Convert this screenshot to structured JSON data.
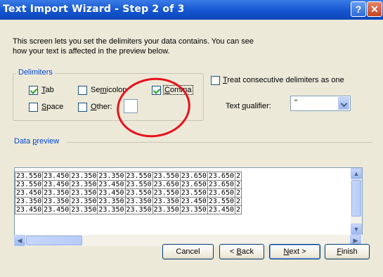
{
  "window": {
    "title": "Text Import Wizard - Step 2 of 3",
    "help_glyph": "?",
    "close_glyph": "✕"
  },
  "intro": {
    "line1": "This screen lets you set the delimiters your data contains.  You can see",
    "line2": "how your text is affected in the preview below."
  },
  "delimiters": {
    "legend": "Delimiters",
    "tab": {
      "label": "Tab",
      "checked": true
    },
    "semicolon": {
      "label": "Semicolon",
      "checked": false
    },
    "comma": {
      "label": "Comma",
      "checked": true
    },
    "space": {
      "label": "Space",
      "checked": false
    },
    "other": {
      "label": "Other:",
      "checked": false,
      "value": ""
    }
  },
  "consecutive": {
    "label": "Treat consecutive delimiters as one",
    "checked": false
  },
  "qualifier": {
    "label": "Text qualifier:",
    "value": "\""
  },
  "preview": {
    "legend": "Data preview",
    "rows": [
      [
        "23.550",
        "23.450",
        "23.350",
        "23.350",
        "23.550",
        "23.550",
        "23.650",
        "23.650",
        "2"
      ],
      [
        "23.550",
        "23.450",
        "23.350",
        "23.450",
        "23.550",
        "23.650",
        "23.650",
        "23.650",
        "2"
      ],
      [
        "23.450",
        "23.350",
        "23.350",
        "23.450",
        "23.550",
        "23.550",
        "23.550",
        "23.650",
        "2"
      ],
      [
        "23.350",
        "23.350",
        "23.350",
        "23.350",
        "23.350",
        "23.350",
        "23.450",
        "23.550",
        "2"
      ],
      [
        "23.450",
        "23.450",
        "23.350",
        "23.350",
        "23.350",
        "23.350",
        "23.350",
        "23.450",
        "2"
      ]
    ]
  },
  "buttons": {
    "cancel": "Cancel",
    "back": "< Back",
    "next": "Next >",
    "finish": "Finish"
  },
  "colors": {
    "title_bar": "#1455d0",
    "legend_text": "#0046d5",
    "dialog_bg": "#ece9d8",
    "annotation": "#e8111d"
  }
}
